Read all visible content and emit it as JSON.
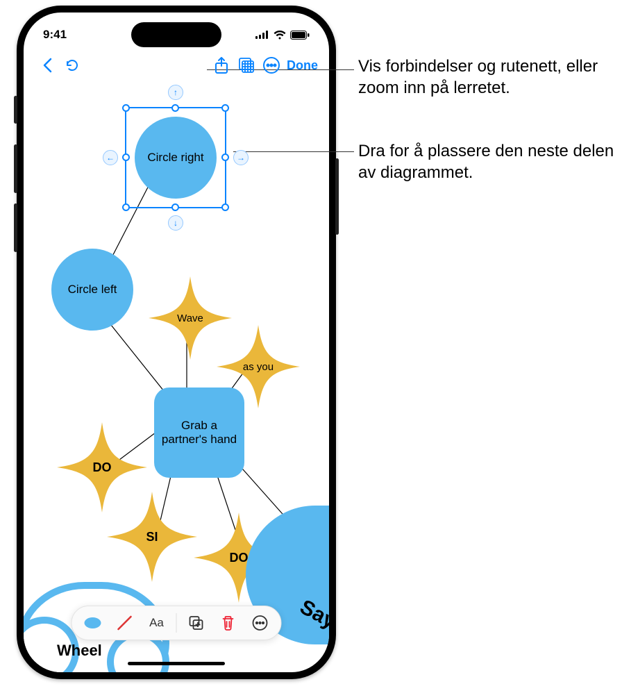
{
  "status": {
    "time": "9:41"
  },
  "toolbar": {
    "done": "Done"
  },
  "diagram": {
    "circle_right": "Circle right",
    "circle_left": "Circle left",
    "grab": "Grab a partner's hand",
    "wave": "Wave",
    "as_you": "as you",
    "do1": "DO",
    "si": "SI",
    "do2": "DO",
    "wheel": "Wheel",
    "say": "Say"
  },
  "callouts": {
    "grid": "Vis forbindelser og rutenett, eller zoom inn på lerretet.",
    "drag": "Dra for å plassere den neste delen av diagrammet."
  }
}
